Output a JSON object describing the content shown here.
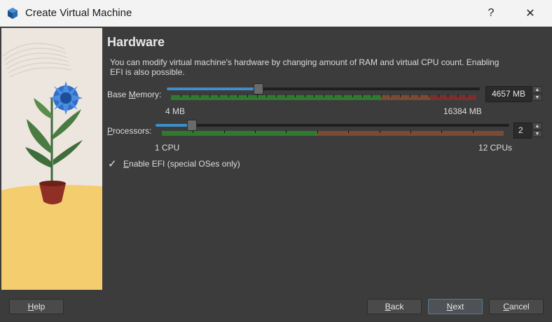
{
  "window": {
    "title": "Create Virtual Machine",
    "help_glyph": "?",
    "close_glyph": "✕"
  },
  "page": {
    "heading": "Hardware",
    "description": "You can modify virtual machine's hardware by changing amount of RAM and virtual CPU count. Enabling EFI is also possible."
  },
  "memory": {
    "label_prefix": "Base ",
    "label_mnemonic": "M",
    "label_suffix": "emory:",
    "value": "4657 MB",
    "min_label": "4 MB",
    "max_label": "16384 MB",
    "min_mb": 4,
    "max_mb": 16384,
    "current_mb": 4657
  },
  "processors": {
    "label_mnemonic": "P",
    "label_suffix": "rocessors:",
    "value": "2",
    "min_label": "1 CPU",
    "max_label": "12 CPUs",
    "min": 1,
    "max": 12,
    "current": 2
  },
  "efi": {
    "checked": true,
    "check_glyph": "✓",
    "label_mnemonic": "E",
    "label_suffix": "nable EFI (special OSes only)"
  },
  "buttons": {
    "help_mnemonic": "H",
    "help_suffix": "elp",
    "back_mnemonic": "B",
    "back_suffix": "ack",
    "next_mnemonic": "N",
    "next_suffix": "ext",
    "cancel_mnemonic": "C",
    "cancel_suffix": "ancel"
  },
  "colors": {
    "accent": "#3d8ec9",
    "safe_green": "#2f7a2f",
    "warn_brown": "#7a4a35",
    "danger_red": "#7a2e2e"
  }
}
